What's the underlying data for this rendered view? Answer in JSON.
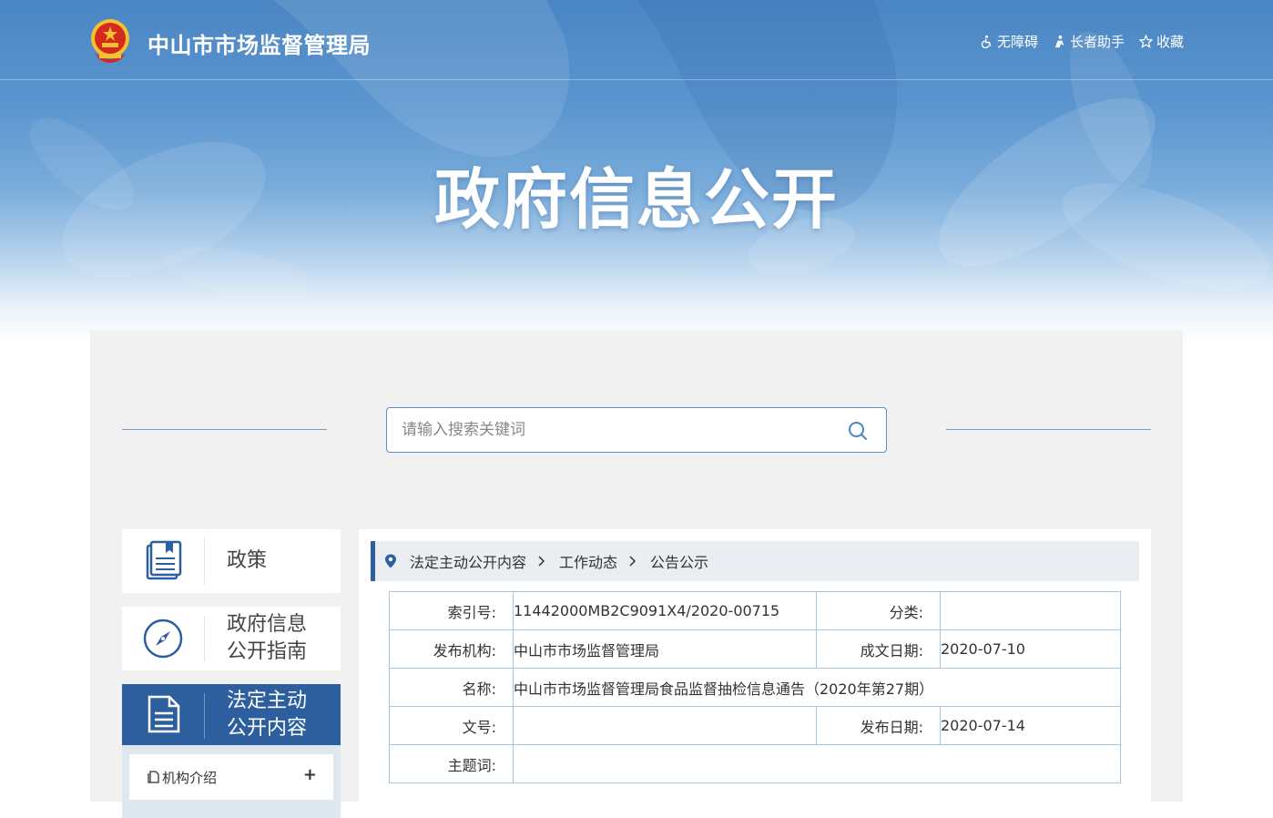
{
  "header": {
    "site_title": "中山市市场监督管理局",
    "links": [
      {
        "icon": "accessibility-icon",
        "label": "无障碍"
      },
      {
        "icon": "elder-assist-icon",
        "label": "长者助手"
      },
      {
        "icon": "star-icon",
        "label": "收藏"
      }
    ]
  },
  "hero": {
    "title": "政府信息公开"
  },
  "search": {
    "placeholder": "请输入搜索关键词"
  },
  "sidebar": {
    "items": [
      {
        "icon": "book-icon",
        "label_1": "政策"
      },
      {
        "icon": "compass-icon",
        "label_1": "政府信息",
        "label_2": "公开指南"
      },
      {
        "icon": "document-icon",
        "label_1": "法定主动",
        "label_2": "公开内容",
        "active": true
      }
    ],
    "sub_items": [
      {
        "icon": "file-icon",
        "label": "机构介绍",
        "toggle": "+"
      }
    ]
  },
  "breadcrumb": [
    "法定主动公开内容",
    "工作动态",
    "公告公示"
  ],
  "info": {
    "index_label": "索引号:",
    "index_value": "11442000MB2C9091X4/2020-00715",
    "category_label": "分类:",
    "category_value": "",
    "publisher_label": "发布机构:",
    "publisher_value": "中山市市场监督管理局",
    "created_label": "成文日期:",
    "created_value": "2020-07-10",
    "name_label": "名称:",
    "name_value": "中山市市场监督管理局食品监督抽检信息通告（2020年第27期）",
    "doc_no_label": "文号:",
    "doc_no_value": "",
    "publish_date_label": "发布日期:",
    "publish_date_value": "2020-07-14",
    "subject_label": "主题词:",
    "subject_value": ""
  },
  "colors": {
    "primary": "#2d5f9e",
    "banner_blue": "#4a86c4",
    "table_border": "#a8c6e0",
    "panel_bg": "#f1f1f1"
  }
}
